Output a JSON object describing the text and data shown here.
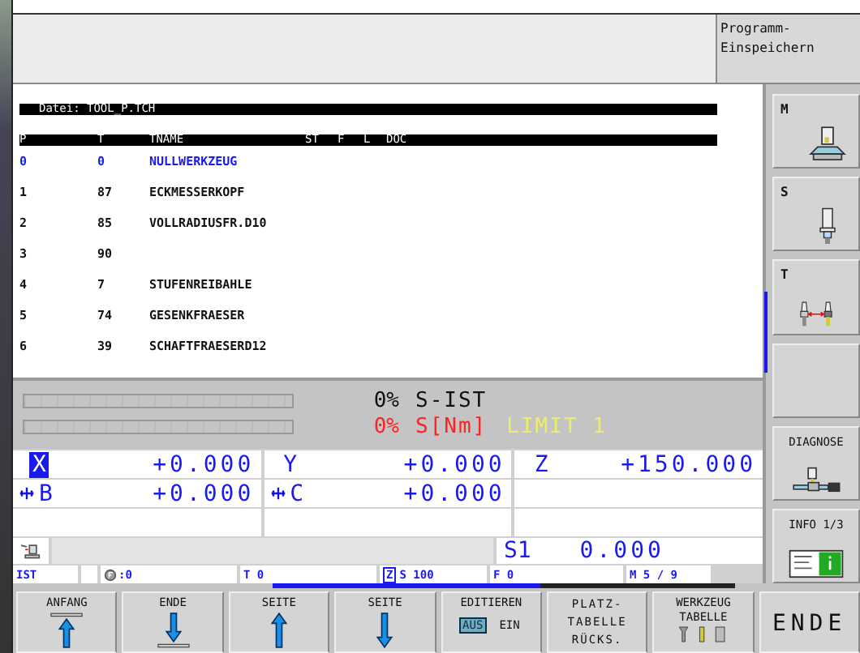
{
  "program_box": {
    "lines": [
      "Programm-",
      "Einspeichern"
    ]
  },
  "file_header": "Datei: TOOL_P.TCH",
  "table": {
    "columns": [
      "P",
      "T",
      "TNAME",
      "ST",
      "F",
      "L",
      "DOC"
    ],
    "rows": [
      {
        "p": "0",
        "t": "0",
        "tname": "NULLWERKZEUG",
        "selected": true
      },
      {
        "p": "1",
        "t": "87",
        "tname": "ECKMESSERKOPF",
        "selected": false
      },
      {
        "p": "2",
        "t": "85",
        "tname": "VOLLRADIUSFR.D10",
        "selected": false
      },
      {
        "p": "3",
        "t": "90",
        "tname": "",
        "selected": false
      },
      {
        "p": "4",
        "t": "7",
        "tname": "STUFENREIBAHLE",
        "selected": false
      },
      {
        "p": "5",
        "t": "74",
        "tname": "GESENKFRAESER",
        "selected": false
      },
      {
        "p": "6",
        "t": "39",
        "tname": "SCHAFTFRAESERD12",
        "selected": false
      }
    ]
  },
  "loads": [
    {
      "kind": "normal",
      "level": 0,
      "percent": "0%",
      "label": "S-IST"
    },
    {
      "kind": "alert",
      "level": 0,
      "percent": "0%",
      "label": "S[Nm]",
      "limit": "LIMIT 1"
    }
  ],
  "axes": [
    [
      {
        "axis": "X",
        "value": "+0.000",
        "selected": true,
        "clamped": false
      },
      {
        "axis": "Y",
        "value": "+0.000",
        "selected": false,
        "clamped": false
      },
      {
        "axis": "Z",
        "value": "+150.000",
        "selected": false,
        "clamped": false
      }
    ],
    [
      {
        "axis": "B",
        "value": "+0.000",
        "selected": false,
        "clamped": true
      },
      {
        "axis": "C",
        "value": "+0.000",
        "selected": false,
        "clamped": true
      }
    ]
  ],
  "spindle_readout": {
    "label": "S1",
    "value": "0.000"
  },
  "status": {
    "mode": "IST",
    "rotation": ":0",
    "tool": "T 0",
    "axis": "Z",
    "speed": "S 100",
    "feed": "F 0",
    "m_functions": "M 5 / 9"
  },
  "side_softkeys": [
    {
      "kind": "machine",
      "label": "M"
    },
    {
      "kind": "spindle",
      "label": "S"
    },
    {
      "kind": "toolchange",
      "label": "T"
    },
    {
      "kind": "blank"
    },
    {
      "kind": "diagnose",
      "label": "DIAGNOSE"
    },
    {
      "kind": "info",
      "label": "INFO 1/3"
    }
  ],
  "bottom_softkeys": [
    {
      "kind": "up-bar",
      "label": "ANFANG"
    },
    {
      "kind": "down-bar",
      "label": "ENDE"
    },
    {
      "kind": "up",
      "label": "SEITE"
    },
    {
      "kind": "down",
      "label": "SEITE"
    },
    {
      "kind": "toggle",
      "label": "EDITIEREN",
      "options": [
        {
          "label": "AUS",
          "selected": true
        },
        {
          "label": "EIN",
          "selected": false
        }
      ]
    },
    {
      "kind": "text",
      "lines": [
        "PLATZ-",
        "TABELLE",
        "RÜCKS."
      ]
    },
    {
      "kind": "tools",
      "lines": [
        "WERKZEUG",
        "TABELLE"
      ]
    },
    {
      "kind": "big",
      "label": "ENDE"
    }
  ]
}
